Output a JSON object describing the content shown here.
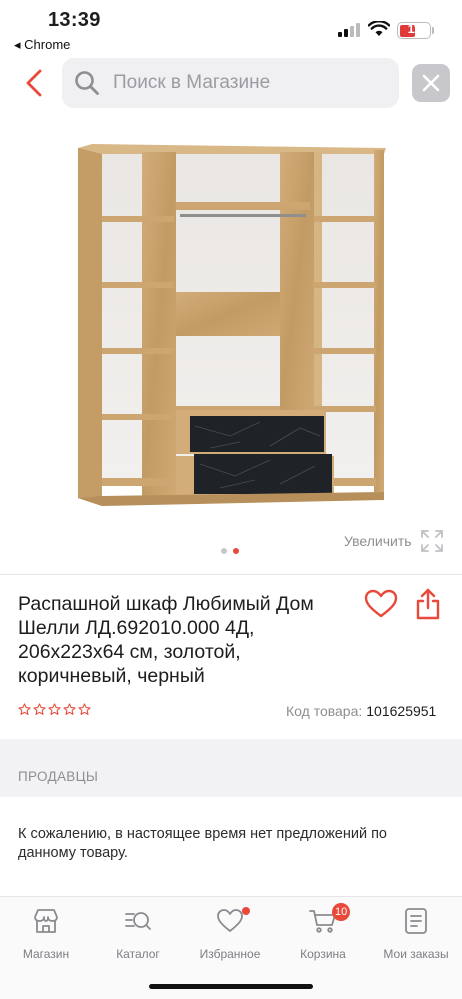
{
  "status_bar": {
    "time": "13:39",
    "back_app": "◂ Chrome",
    "battery_level": "11"
  },
  "search": {
    "placeholder": "Поиск в Магазине"
  },
  "gallery": {
    "zoom_label": "Увеличить",
    "image_count": 2,
    "active_index": 1
  },
  "product": {
    "title": "Распашной шкаф Любимый Дом Шелли ЛД.692010.000 4Д, 206х223х64 см, золотой, коричневый, черный",
    "rating": 0,
    "rating_max": 5,
    "code_label": "Код товара:",
    "code_value": "101625951"
  },
  "sellers": {
    "section_title": "ПРОДАВЦЫ",
    "empty_message": "К сожалению, в настоящее время нет предложений по данному товару."
  },
  "tabs": [
    {
      "label": "Магазин",
      "icon": "store-icon"
    },
    {
      "label": "Каталог",
      "icon": "catalog-search-icon"
    },
    {
      "label": "Избранное",
      "icon": "heart-icon",
      "has_dot": true
    },
    {
      "label": "Корзина",
      "icon": "cart-icon",
      "badge": "10"
    },
    {
      "label": "Мои заказы",
      "icon": "orders-icon"
    }
  ],
  "colors": {
    "accent": "#e8493a",
    "wood": "#c9a371",
    "drawer_front": "#1f2327"
  }
}
